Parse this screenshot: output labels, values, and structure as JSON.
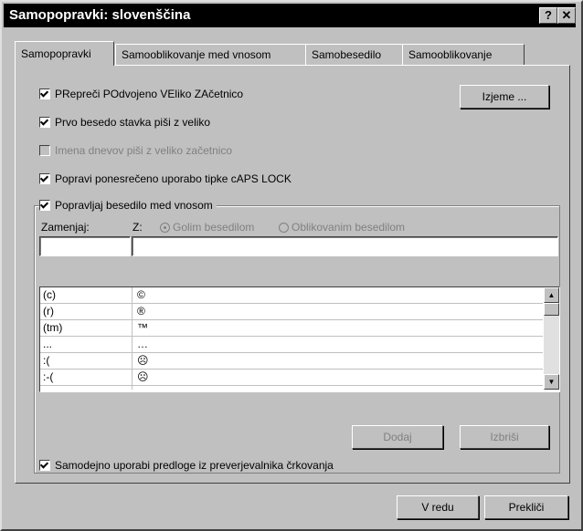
{
  "window": {
    "title": "Samopopravki: slovenščina",
    "help_glyph": "?",
    "close_glyph": "✕"
  },
  "tabs": [
    {
      "label": "Samopopravki",
      "active": true
    },
    {
      "label": "Samooblikovanje med vnosom",
      "active": false
    },
    {
      "label": "Samobesedilo",
      "active": false
    },
    {
      "label": "Samooblikovanje",
      "active": false
    }
  ],
  "options": {
    "two_caps": "PRepreči POdvojeno VEliko ZAčetnico",
    "first_letter": "Prvo besedo stavka piši z veliko",
    "day_names": "Imena dnevov piši z veliko začetnico",
    "caps_lock": "Popravi ponesrečeno uporabo tipke cAPS LOCK",
    "replace_text": "Popravljaj besedilo med vnosom",
    "spelling": "Samodejno uporabi predloge iz preverjevalnika črkovanja"
  },
  "buttons": {
    "exceptions": "Izjeme ...",
    "add": "Dodaj",
    "delete": "Izbriši",
    "ok": "V redu",
    "cancel": "Prekliči"
  },
  "replace": {
    "replace_label": "Zamenjaj:",
    "with_label": "Z:",
    "plain_text": "Golim besedilom",
    "formatted_text": "Oblikovanim besedilom",
    "replace_value": "",
    "with_value": ""
  },
  "entries": [
    {
      "from": "(c)",
      "to": "©"
    },
    {
      "from": "(r)",
      "to": "®"
    },
    {
      "from": "(tm)",
      "to": "™"
    },
    {
      "from": "...",
      "to": "…"
    },
    {
      "from": ":(",
      "to": "☹"
    },
    {
      "from": ":-(",
      "to": "☹"
    }
  ]
}
